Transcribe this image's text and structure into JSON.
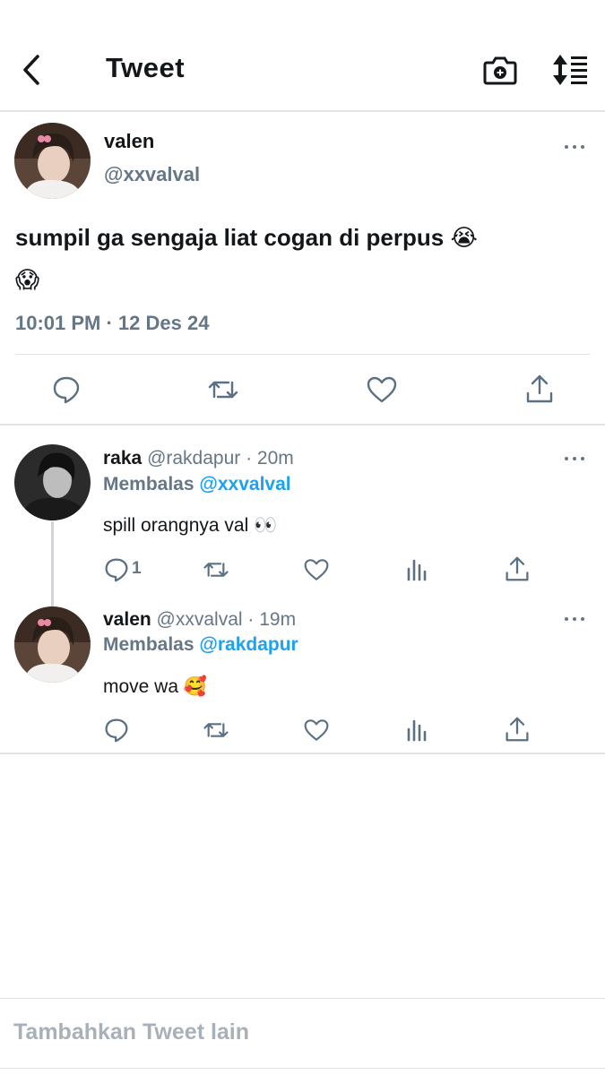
{
  "header": {
    "title": "Tweet"
  },
  "main_tweet": {
    "author_name": "valen",
    "author_handle": "@xxvalval",
    "text": "sumpil ga sengaja liat cogan di perpus",
    "emoji_1": "😭",
    "emoji_2": "😱",
    "timestamp": "10:01 PM · 12 Des 24"
  },
  "replies": [
    {
      "name": "raka",
      "handle_time": "@rakdapur · 20m",
      "replying_prefix": "Membalas",
      "replying_to": "@xxvalval",
      "text": "spill orangnya val",
      "emoji": "👀",
      "reply_count": "1"
    },
    {
      "name": "valen",
      "handle_time": "@xxvalval · 19m",
      "replying_prefix": "Membalas",
      "replying_to": "@rakdapur",
      "text": "move wa",
      "emoji": "🥰",
      "reply_count": ""
    }
  ],
  "compose": {
    "placeholder": "Tambahkan Tweet lain"
  },
  "colors": {
    "accent": "#1da1f2",
    "secondary_text": "#657786",
    "icon": "#5b7083",
    "divider": "#e1e4e6"
  }
}
